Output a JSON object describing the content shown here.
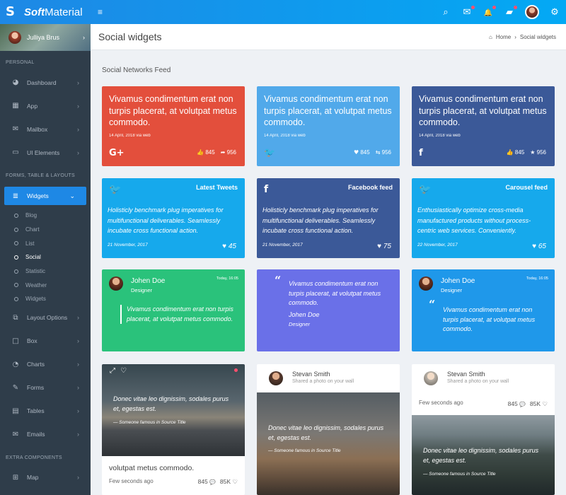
{
  "app": {
    "brand_bold": "Soft",
    "brand_rest": "Material",
    "logo": "S"
  },
  "topbar": {
    "menu_icon": "≡",
    "search_icon": "⌕",
    "mail_icon": "✉",
    "bell_icon": "🔔",
    "chat_icon": "▰",
    "gear_icon": "⚙"
  },
  "user": {
    "name": "Julliya Brus",
    "caret": "›"
  },
  "sidebar": {
    "section_personal": "PERSONAL",
    "section_forms": "FORMS, TABLE & LAYOUTS",
    "section_extra": "EXTRA COMPONENTS",
    "personal": [
      {
        "label": "Dashboard",
        "icon": "◕"
      },
      {
        "label": "App",
        "icon": "▦"
      },
      {
        "label": "Mailbox",
        "icon": "✉"
      },
      {
        "label": "UI Elements",
        "icon": "▭"
      }
    ],
    "active": {
      "label": "Widgets",
      "icon": "≣",
      "arrow": "⌄"
    },
    "sub_items": [
      "Blog",
      "Chart",
      "List",
      "Social",
      "Statistic",
      "Weather",
      "Widgets"
    ],
    "after": [
      {
        "label": "Layout Options",
        "icon": "⧉"
      },
      {
        "label": "Box",
        "icon": "□"
      },
      {
        "label": "Charts",
        "icon": "◔"
      },
      {
        "label": "Forms",
        "icon": "✎"
      },
      {
        "label": "Tables",
        "icon": "▤"
      },
      {
        "label": "Emails",
        "icon": "✉"
      }
    ],
    "extra": [
      {
        "label": "Map",
        "icon": "⊞"
      }
    ],
    "arrow": "›"
  },
  "header": {
    "title": "Social widgets",
    "home_icon": "⌂",
    "home": "Home",
    "sep": "›",
    "current": "Social widgets"
  },
  "section_title": "Social Networks Feed",
  "posts": [
    {
      "text": "Vivamus condimentum erat non turpis placerat, at volutpat metus commodo.",
      "meta": "14 April, 2018 via web",
      "network_icon": "G+",
      "likes": "845",
      "shares": "956",
      "like_icon": "👍",
      "share_icon": "➦"
    },
    {
      "text": "Vivamus condimentum erat non turpis placerat, at volutpat metus commodo.",
      "meta": "14 April, 2018 via web",
      "network_icon": "🐦",
      "likes": "845",
      "shares": "956",
      "like_icon": "♥",
      "share_icon": "⇆"
    },
    {
      "text": "Vivamus condimentum erat non turpis placerat, at volutpat metus commodo.",
      "meta": "14 April, 2018 via web",
      "network_icon": "f",
      "likes": "845",
      "shares": "956",
      "like_icon": "👍",
      "share_icon": "★"
    }
  ],
  "feeds": [
    {
      "icon": "🐦",
      "title": "Latest Tweets",
      "text": "Holisticly benchmark plug imperatives for multifunctional deliverables. Seamlessly incubate cross functional action.",
      "date": "21 November, 2017",
      "likes": "45",
      "heart": "♥"
    },
    {
      "icon": "f",
      "title": "Facebook feed",
      "text": "Holisticly benchmark plug imperatives for multifunctional deliverables. Seamlessly incubate cross functional action.",
      "date": "21 November, 2017",
      "likes": "75",
      "heart": "♥"
    },
    {
      "icon": "🐦",
      "title": "Carousel feed",
      "text": "Enthusiastically optimize cross-media manufactured products without process-centric web services. Conveniently.",
      "date": "22 November, 2017",
      "likes": "65",
      "heart": "♥"
    }
  ],
  "quotes": [
    {
      "name": "Johen Doe",
      "role": "Designer",
      "time": "Today, 16:05",
      "text": "Vivamus condimentum erat non turpis placerat, at volutpat metus commodo."
    },
    {
      "mark": "“",
      "text": "Vivamus condimentum erat non turpis placerat, at volutpat metus commodo.",
      "name": "Johen Doe",
      "role": "Designer"
    },
    {
      "name": "Johen Doe",
      "role": "Designer",
      "time": "Today, 16:05",
      "mark": "“",
      "text": "Vivamus condimentum erat non turpis placerat, at volutpat metus commodo."
    }
  ],
  "photo_cards": [
    {
      "expand_icon": "⤢",
      "heart_icon": "♡",
      "quote": "Donec vitae leo dignissim, sodales purus et, egestas est.",
      "source": "— Someone famous in Source Title",
      "caption": "volutpat metus commodo.",
      "time": "Few seconds ago",
      "comments": "845",
      "likes": "85K",
      "comment_icon": "💬",
      "like_icon": "♡"
    },
    {
      "name": "Stevan Smith",
      "subtitle": "Shared a photo on your wall",
      "quote": "Donec vitae leo dignissim, sodales purus et, egestas est.",
      "source": "— Someone famous in Source Title"
    },
    {
      "name": "Stevan Smith",
      "subtitle": "Shared a photo on your wall",
      "time": "Few seconds ago",
      "comments": "845",
      "likes": "85K",
      "comment_icon": "💬",
      "like_icon": "♡",
      "quote": "Donec vitae leo dignissim, sodales purus et, egestas est.",
      "source": "— Someone famous in Source Title"
    }
  ]
}
